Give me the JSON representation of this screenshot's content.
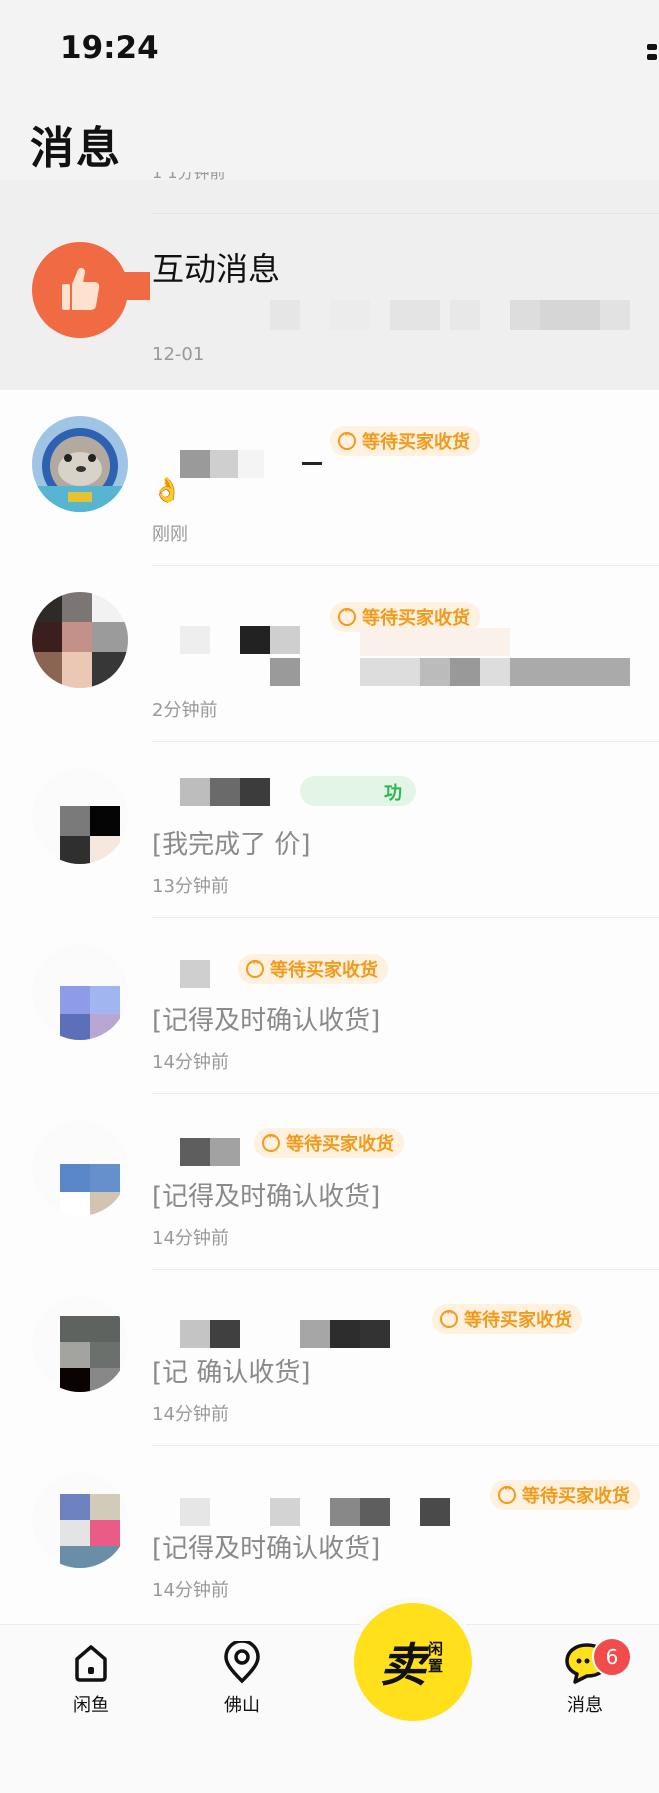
{
  "status_bar": {
    "time": "19:24"
  },
  "header": {
    "title": "消息",
    "partial_timestamp": "1 1分钟前"
  },
  "interaction": {
    "title": "互动消息",
    "time": "12-01"
  },
  "conversations": [
    {
      "status": "等待买家收货",
      "message": "👌",
      "time": "刚刚"
    },
    {
      "status": "等待买家收货",
      "message": "",
      "time": "2分钟前"
    },
    {
      "status": "功",
      "message": "[我完成了   价]",
      "time": "13分钟前"
    },
    {
      "status": "等待买家收货",
      "message": "[记得及时确认收货]",
      "time": "14分钟前"
    },
    {
      "status": "等待买家收货",
      "message": "[记得及时确认收货]",
      "time": "14分钟前"
    },
    {
      "status": "等待买家收货",
      "message": "[记 确认收货]",
      "time": "14分钟前"
    },
    {
      "status": "等待买家收货",
      "message": "[记得及时确认收货]",
      "time": "14分钟前"
    }
  ],
  "tab_bar": {
    "tabs": [
      {
        "label": "闲鱼",
        "icon": "home-icon"
      },
      {
        "label": "佛山",
        "icon": "location-pin-icon"
      },
      {
        "label": "消息",
        "icon": "chat-bubble-icon"
      }
    ],
    "sell_main": "卖",
    "sell_sub": "闲置",
    "unread_count": "6"
  },
  "colors": {
    "accent_yellow": "#ffe01b",
    "badge_orange": "#f29a1b",
    "success_green": "#2fb451",
    "interaction_orange": "#f06a43",
    "unread_red": "#f24b4b"
  }
}
